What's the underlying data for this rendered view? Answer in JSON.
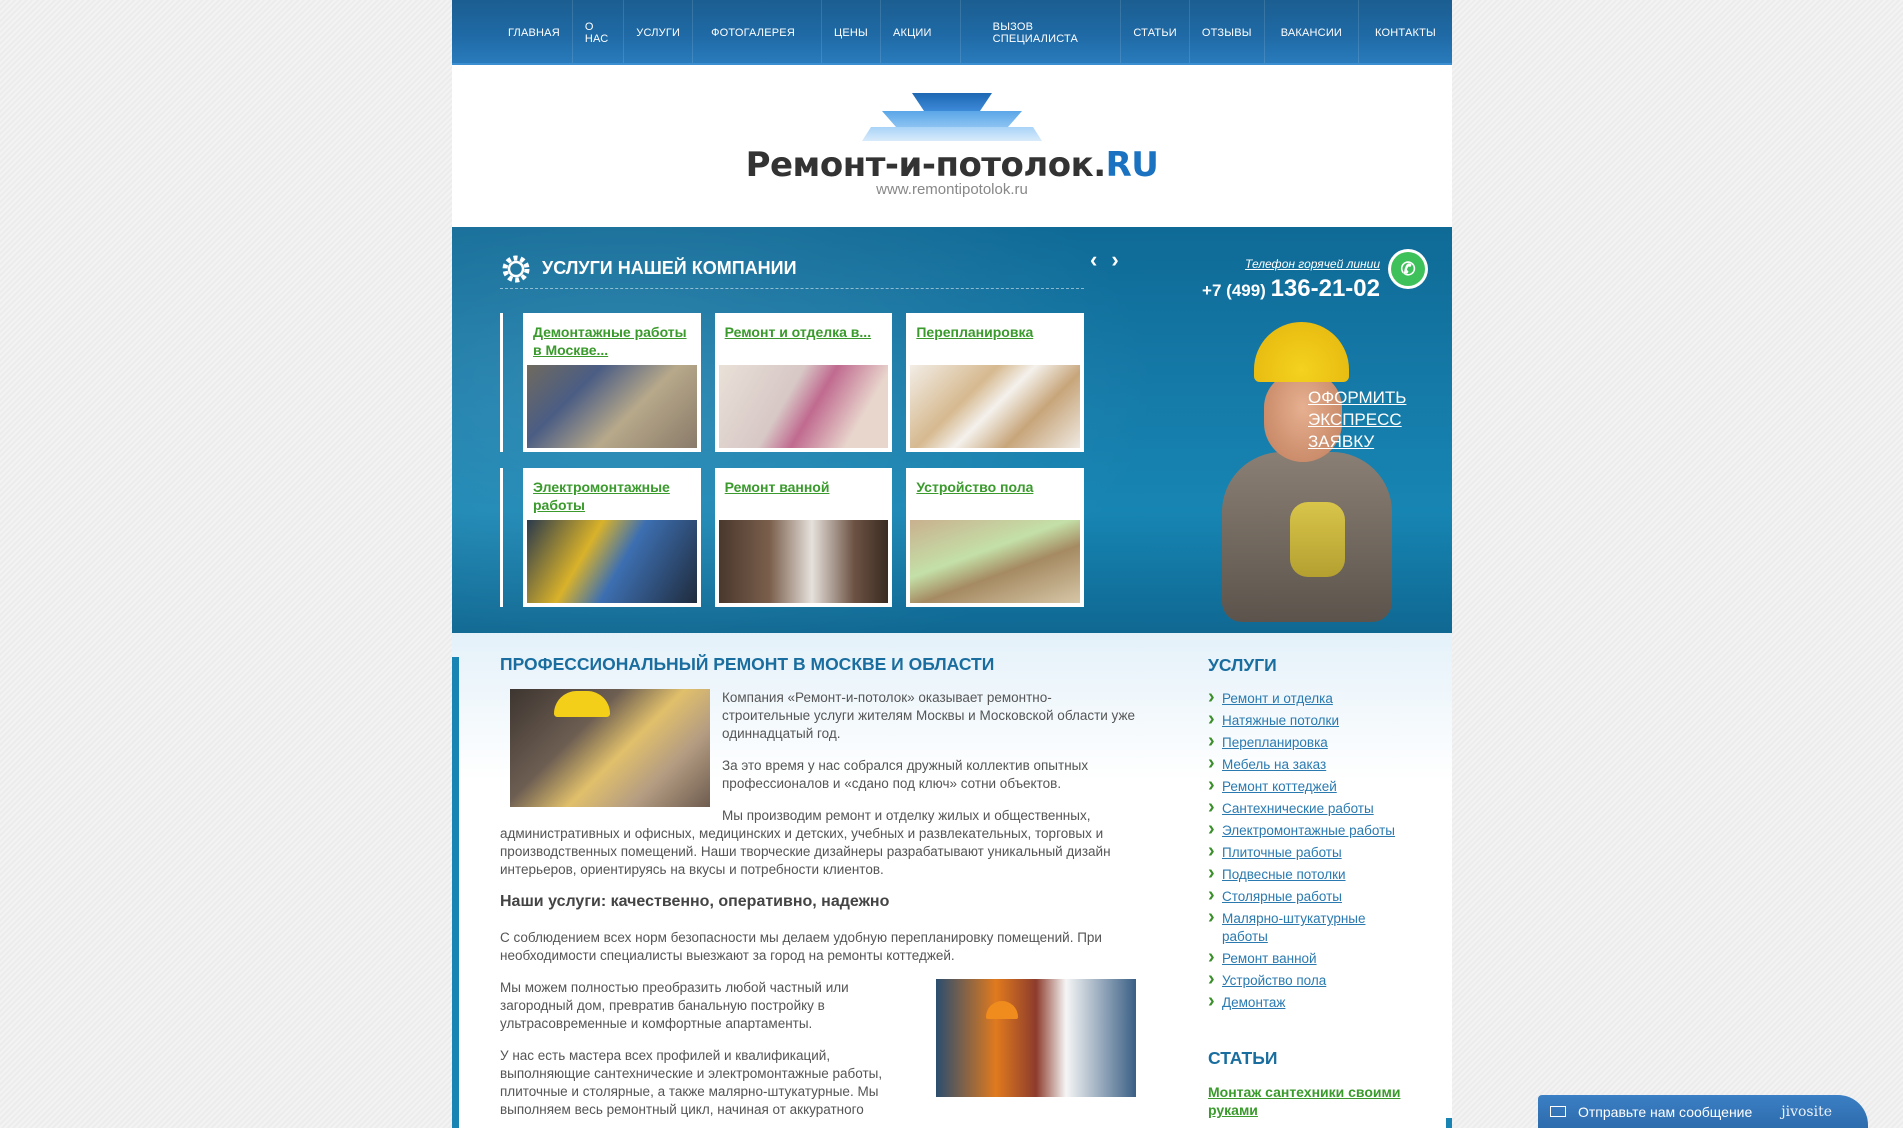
{
  "nav": {
    "items": [
      "ГЛАВНАЯ",
      "О НАС",
      "УСЛУГИ",
      "ФОТОГАЛЕРЕЯ",
      "ЦЕНЫ",
      "АКЦИИ",
      "ВЫЗОВ СПЕЦИАЛИСТА",
      "СТАТЬИ",
      "ОТЗЫВЫ",
      "ВАКАНСИИ",
      "КОНТАКТЫ"
    ]
  },
  "header": {
    "logo_main": "Ремонт-и-потолок.",
    "logo_ru": "RU",
    "logo_url": "www.remontipotolok.ru"
  },
  "hero": {
    "title": "УСЛУГИ НАШЕЙ КОМПАНИИ",
    "prev": "‹",
    "next": "›",
    "cards": [
      {
        "title": "Демонтажные работы в Москве..."
      },
      {
        "title": "Ремонт и отделка в..."
      },
      {
        "title": "Перепланировка"
      },
      {
        "title": "Электромонтажные работы"
      },
      {
        "title": "Ремонт ванной"
      },
      {
        "title": "Устройство пола"
      }
    ],
    "hotline_label": "Телефон горячей линии",
    "phone_code": "+7 (499)",
    "phone_number": "136-21-02",
    "express": "ОФОРМИТЬ ЭКСПРЕСС ЗАЯВКУ"
  },
  "main": {
    "heading": "ПРОФЕССИОНАЛЬНЫЙ РЕМОНТ В МОСКВЕ И ОБЛАСТИ",
    "p1": "Компания «Ремонт-и-потолок» оказывает ремонтно-строительные услуги жителям Москвы и Московской области уже одиннадцатый год.",
    "p2": "За это время у нас собрался дружный коллектив опытных профессионалов и «сдано под ключ» сотни объектов.",
    "p3": "Мы производим ремонт и отделку жилых и общественных, административных и офисных, медицинских и детских, учебных и развлекательных, торговых и производственных помещений. Наши творческие дизайнеры разрабатывают уникальный дизайн интерьеров, ориентируясь на вкусы и потребности клиентов.",
    "subheading": "Наши услуги: качественно, оперативно, надежно",
    "p4": "С соблюдением всех норм безопасности мы делаем удобную перепланировку помещений. При необходимости специалисты выезжают за город на ремонты коттеджей.",
    "p5": "Мы можем полностью преобразить любой частный или загородный дом, превратив банальную постройку в ультрасовременные и комфортные апартаменты.",
    "p6": "У нас есть мастера всех профилей и квалификаций, выполняющие сантехнические и электромонтажные работы, плиточные и столярные, а также малярно-штукатурные. Мы выполняем весь ремонтный цикл, начиная от аккуратного"
  },
  "sidebar": {
    "services_title": "УСЛУГИ",
    "services": [
      "Ремонт и отделка",
      "Натяжные потолки",
      "Перепланировка",
      "Мебель на заказ",
      "Ремонт коттеджей",
      "Сантехнические работы",
      "Электромонтажные работы",
      "Плиточные работы",
      "Подвесные потолки",
      "Столярные работы",
      "Малярно-штукатурные работы",
      "Ремонт ванной",
      "Устройство пола",
      "Демонтаж"
    ],
    "articles_title": "СТАТЬИ",
    "article": "Монтаж сантехники своими руками"
  },
  "chat": {
    "label": "Отправьте нам сообщение",
    "brand": "jivosite"
  }
}
